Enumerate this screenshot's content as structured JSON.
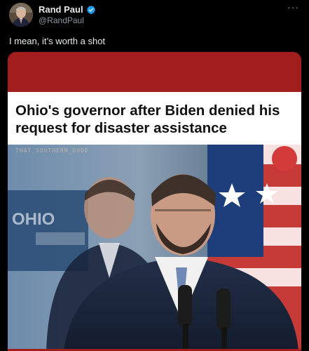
{
  "author": {
    "name": "Rand Paul",
    "handle": "@RandPaul",
    "verified_color": "#1d9bf0"
  },
  "more_menu": {
    "glyph": "···",
    "icon": "more-horizontal-icon"
  },
  "tweet": {
    "text": "I mean, it’s worth a shot"
  },
  "media": {
    "headline": "Ohio's governor after Biden denied his request for disaster assistance",
    "watermark": "THAT_SOUTHERN_DUDE",
    "podium_sign": "OHIO",
    "accent_color": "#a11e1d"
  }
}
